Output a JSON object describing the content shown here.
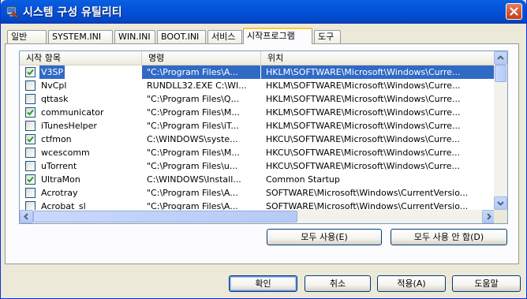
{
  "window": {
    "title": "시스템 구성 유틸리티"
  },
  "tabs": [
    "일반",
    "SYSTEM.INI",
    "WIN.INI",
    "BOOT.INI",
    "서비스",
    "시작프로그램",
    "도구"
  ],
  "active_tab": "시작프로그램",
  "columns": [
    "시작 항목",
    "명령",
    "위치"
  ],
  "rows": [
    {
      "checked": true,
      "name": "V3SP",
      "command": "\"C:\\Program Files\\A...",
      "location": "HKLM\\SOFTWARE\\Microsoft\\Windows\\Curre...",
      "selected": true
    },
    {
      "checked": false,
      "name": "NvCpl",
      "command": "RUNDLL32.EXE C:\\WI...",
      "location": "HKLM\\SOFTWARE\\Microsoft\\Windows\\Curre...",
      "selected": false
    },
    {
      "checked": false,
      "name": "qttask",
      "command": "\"C:\\Program Files\\Q...",
      "location": "HKLM\\SOFTWARE\\Microsoft\\Windows\\Curre...",
      "selected": false
    },
    {
      "checked": true,
      "name": "communicator",
      "command": "\"C:\\Program Files\\M...",
      "location": "HKLM\\SOFTWARE\\Microsoft\\Windows\\Curre...",
      "selected": false
    },
    {
      "checked": false,
      "name": "iTunesHelper",
      "command": "\"C:\\Program Files\\iT...",
      "location": "HKLM\\SOFTWARE\\Microsoft\\Windows\\Curre...",
      "selected": false
    },
    {
      "checked": true,
      "name": "ctfmon",
      "command": "C:\\WINDOWS\\syste...",
      "location": "HKCU\\SOFTWARE\\Microsoft\\Windows\\Curre...",
      "selected": false
    },
    {
      "checked": false,
      "name": "wcescomm",
      "command": "\"C:\\Program Files\\M...",
      "location": "HKCU\\SOFTWARE\\Microsoft\\Windows\\Curre...",
      "selected": false
    },
    {
      "checked": false,
      "name": "uTorrent",
      "command": "\"C:\\Program Files\\u...",
      "location": "HKCU\\SOFTWARE\\Microsoft\\Windows\\Curre...",
      "selected": false
    },
    {
      "checked": true,
      "name": "UltraMon",
      "command": "C:\\WINDOWS\\Install...",
      "location": "Common Startup",
      "selected": false
    },
    {
      "checked": false,
      "name": "Acrotray",
      "command": "\"C:\\Program Files\\A...",
      "location": "SOFTWARE\\Microsoft\\Windows\\CurrentVersio...",
      "selected": false
    },
    {
      "checked": false,
      "name": "Acrobat_sl",
      "command": "\"C:\\Program Files\\A...",
      "location": "SOFTWARE\\Microsoft\\Windows\\CurrentVersio...",
      "selected": false
    }
  ],
  "panel_buttons": {
    "enable_all": "모두 사용(E)",
    "disable_all": "모두 사용 안 함(D)"
  },
  "dialog_buttons": {
    "ok": "확인",
    "cancel": "취소",
    "apply": "적용(A)",
    "help": "도움말"
  },
  "colors": {
    "title_bar": "#0453D8",
    "selection": "#316AC5",
    "dialog_bg": "#ECE9D8"
  }
}
